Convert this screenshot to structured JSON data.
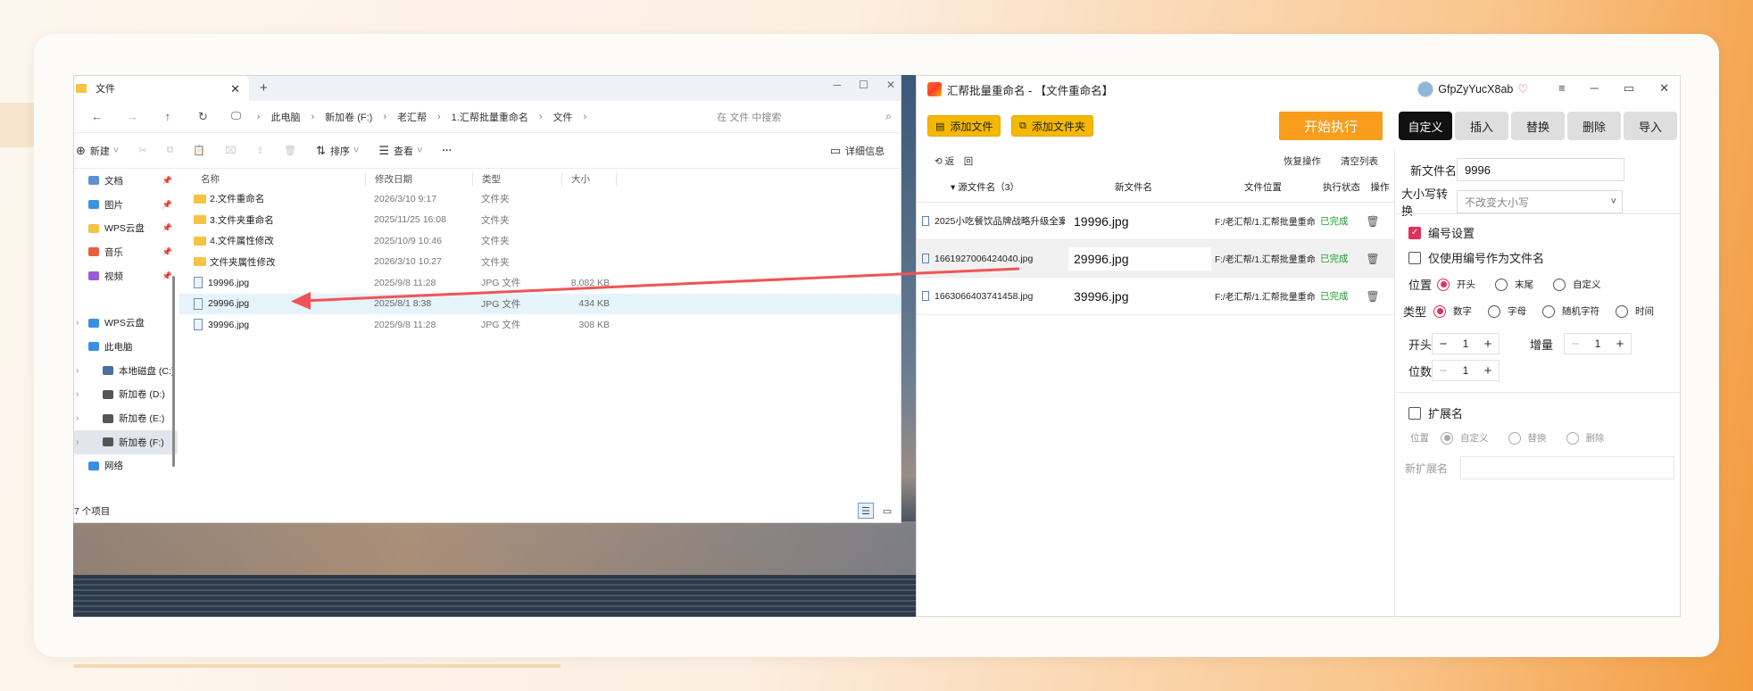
{
  "explorer": {
    "tab_title": "文件",
    "new_tab": "+",
    "breadcrumbs": [
      "此电脑",
      "新加卷 (F:)",
      "老汇帮",
      "1.汇帮批量重命名",
      "文件"
    ],
    "search_placeholder": "在 文件 中搜索",
    "toolbar": {
      "new_label": "新建",
      "sort_label": "排序",
      "view_label": "查看",
      "more_label": "···",
      "details_label": "详细信息"
    },
    "nav_pinned": [
      {
        "label": "文档",
        "color": "#5b8fd6"
      },
      {
        "label": "图片",
        "color": "#3b93e0"
      },
      {
        "label": "WPS云盘",
        "color": "#f6c344"
      },
      {
        "label": "音乐",
        "color": "#e8603c"
      },
      {
        "label": "视频",
        "color": "#9a5bd8"
      }
    ],
    "nav_tree": [
      {
        "label": "WPS云盘",
        "color": "#3a8ee6"
      },
      {
        "label": "此电脑",
        "color": "#3a8ee6"
      },
      {
        "label": "本地磁盘 (C:)",
        "color": "#4a6fa5"
      },
      {
        "label": "新加卷 (D:)",
        "color": "#555555"
      },
      {
        "label": "新加卷 (E:)",
        "color": "#555555"
      },
      {
        "label": "新加卷 (F:)",
        "color": "#555555"
      },
      {
        "label": "网络",
        "color": "#3a8ee6"
      }
    ],
    "columns": {
      "name": "名称",
      "date": "修改日期",
      "type": "类型",
      "size": "大小"
    },
    "files": [
      {
        "name": "2.文件重命名",
        "date": "2026/3/10 9:17",
        "type": "文件夹",
        "size": "",
        "kind": "folder"
      },
      {
        "name": "3.文件夹重命名",
        "date": "2025/11/25 16:08",
        "type": "文件夹",
        "size": "",
        "kind": "folder"
      },
      {
        "name": "4.文件属性修改",
        "date": "2025/10/9 10:46",
        "type": "文件夹",
        "size": "",
        "kind": "folder"
      },
      {
        "name": "文件夹属性修改",
        "date": "2026/3/10 10:27",
        "type": "文件夹",
        "size": "",
        "kind": "folder"
      },
      {
        "name": "19996.jpg",
        "date": "2025/9/8 11:28",
        "type": "JPG 文件",
        "size": "8,082 KB",
        "kind": "jpg"
      },
      {
        "name": "29996.jpg",
        "date": "2025/8/1 8:38",
        "type": "JPG 文件",
        "size": "434 KB",
        "kind": "jpg"
      },
      {
        "name": "39996.jpg",
        "date": "2025/9/8 11:28",
        "type": "JPG 文件",
        "size": "308 KB",
        "kind": "jpg"
      }
    ],
    "status_count": "7 个项目"
  },
  "app": {
    "title": "汇帮批量重命名 - 【文件重命名】",
    "username": "GfpZyYucX8ab",
    "add_file": "添加文件",
    "add_folder": "添加文件夹",
    "start": "开始执行",
    "modes": [
      "自定义",
      "插入",
      "替换",
      "删除",
      "导入"
    ],
    "undo": "返　回",
    "restore": "恢复操作",
    "clear": "清空列表",
    "table_headers": {
      "src": "▾ 源文件名（3）",
      "new": "新文件名",
      "loc": "文件位置",
      "status": "执行状态",
      "op": "操作"
    },
    "rows": [
      {
        "src": "2025小吃餐饮品牌战略升级全案",
        "new": "19996.jpg",
        "loc": "F:/老汇帮/1.汇帮批量重命",
        "status": "已完成"
      },
      {
        "src": "1661927006424040.jpg",
        "new": "29996.jpg",
        "loc": "F:/老汇帮/1.汇帮批量重命",
        "status": "已完成"
      },
      {
        "src": "1663066403741458.jpg",
        "new": "39996.jpg",
        "loc": "F:/老汇帮/1.汇帮批量重命",
        "status": "已完成"
      }
    ],
    "settings": {
      "new_name_label": "新文件名",
      "new_name_value": "9996",
      "case_label": "大小写转换",
      "case_value": "不改变大小写",
      "numbering_label": "编号设置",
      "only_number_label": "仅使用编号作为文件名",
      "position_label": "位置",
      "positions": [
        "开头",
        "末尾",
        "自定义"
      ],
      "type_label": "类型",
      "types": [
        "数字",
        "字母",
        "随机字符",
        "时间"
      ],
      "start_label": "开头",
      "start_value": "1",
      "increment_label": "增量",
      "increment_value": "1",
      "digits_label": "位数",
      "digits_value": "1",
      "ext_label": "扩展名",
      "ext_position_label": "位置",
      "ext_options": [
        "自定义",
        "替换",
        "删除"
      ],
      "new_ext_label": "新扩展名"
    }
  }
}
